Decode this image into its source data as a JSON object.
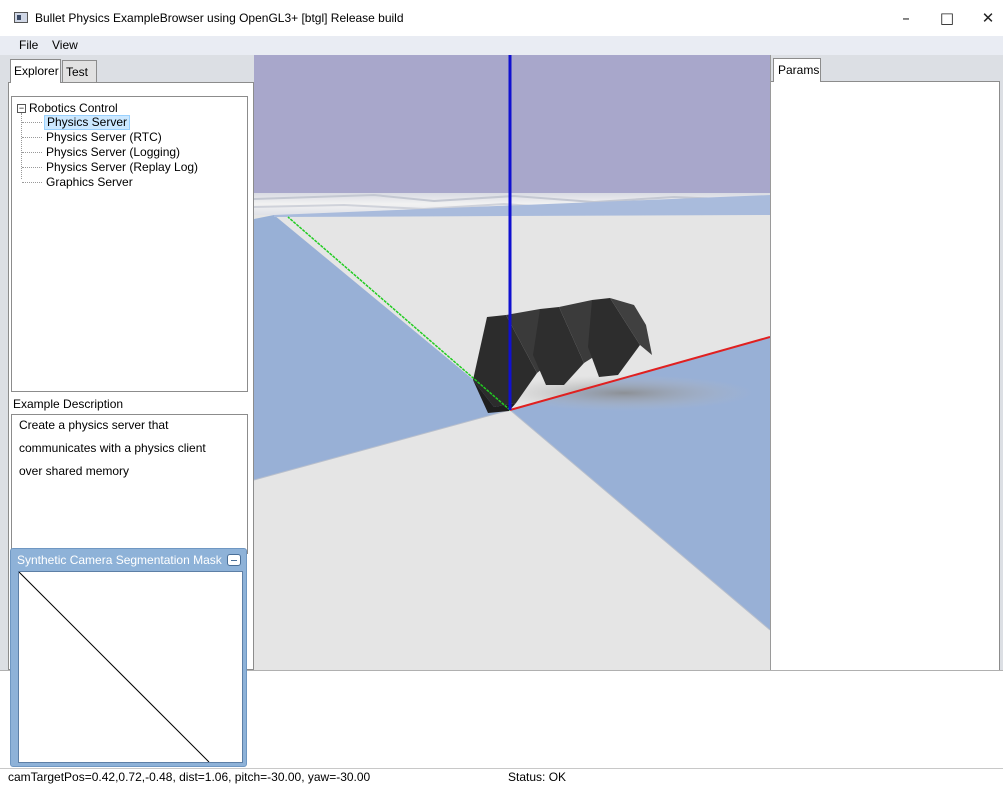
{
  "window": {
    "title": "Bullet Physics ExampleBrowser using OpenGL3+ [btgl] Release build",
    "minimize_glyph": "–",
    "maximize_glyph": "□",
    "close_glyph": "✕"
  },
  "menu": {
    "items": [
      "File",
      "View"
    ]
  },
  "explorer": {
    "tabs": [
      "Explorer",
      "Test"
    ],
    "active_tab": "Explorer",
    "tree": {
      "root_toggle": "−",
      "root": "Robotics Control",
      "items": [
        "Physics Server",
        "Physics Server (RTC)",
        "Physics Server (Logging)",
        "Physics Server (Replay Log)",
        "Graphics Server"
      ],
      "selected": "Physics Server"
    },
    "description_label": "Example Description",
    "description_lines": [
      "Create a physics server that",
      "communicates with a physics client",
      "over shared memory"
    ]
  },
  "segmentation_window": {
    "title": "Synthetic Camera Segmentation Mask"
  },
  "params": {
    "tab": "Params"
  },
  "status": {
    "camera": "camTargetPos=0.42,0.72,-0.48, dist=1.06, pitch=-30.00, yaw=-30.00",
    "state": "Status: OK"
  },
  "colors": {
    "sky": "#a8a7cb",
    "ground_light": "#e5e5e5",
    "ground_blue": "#98b0d6",
    "axis_x": "#e02020",
    "axis_y": "#22cc22",
    "axis_z": "#1010d0",
    "robot": "#333333",
    "selection": "#cce8ff"
  },
  "icons": {
    "app": "window-app-icon",
    "tree_toggle": "tree-collapse-icon",
    "seg_window_button": "minimize-icon"
  }
}
